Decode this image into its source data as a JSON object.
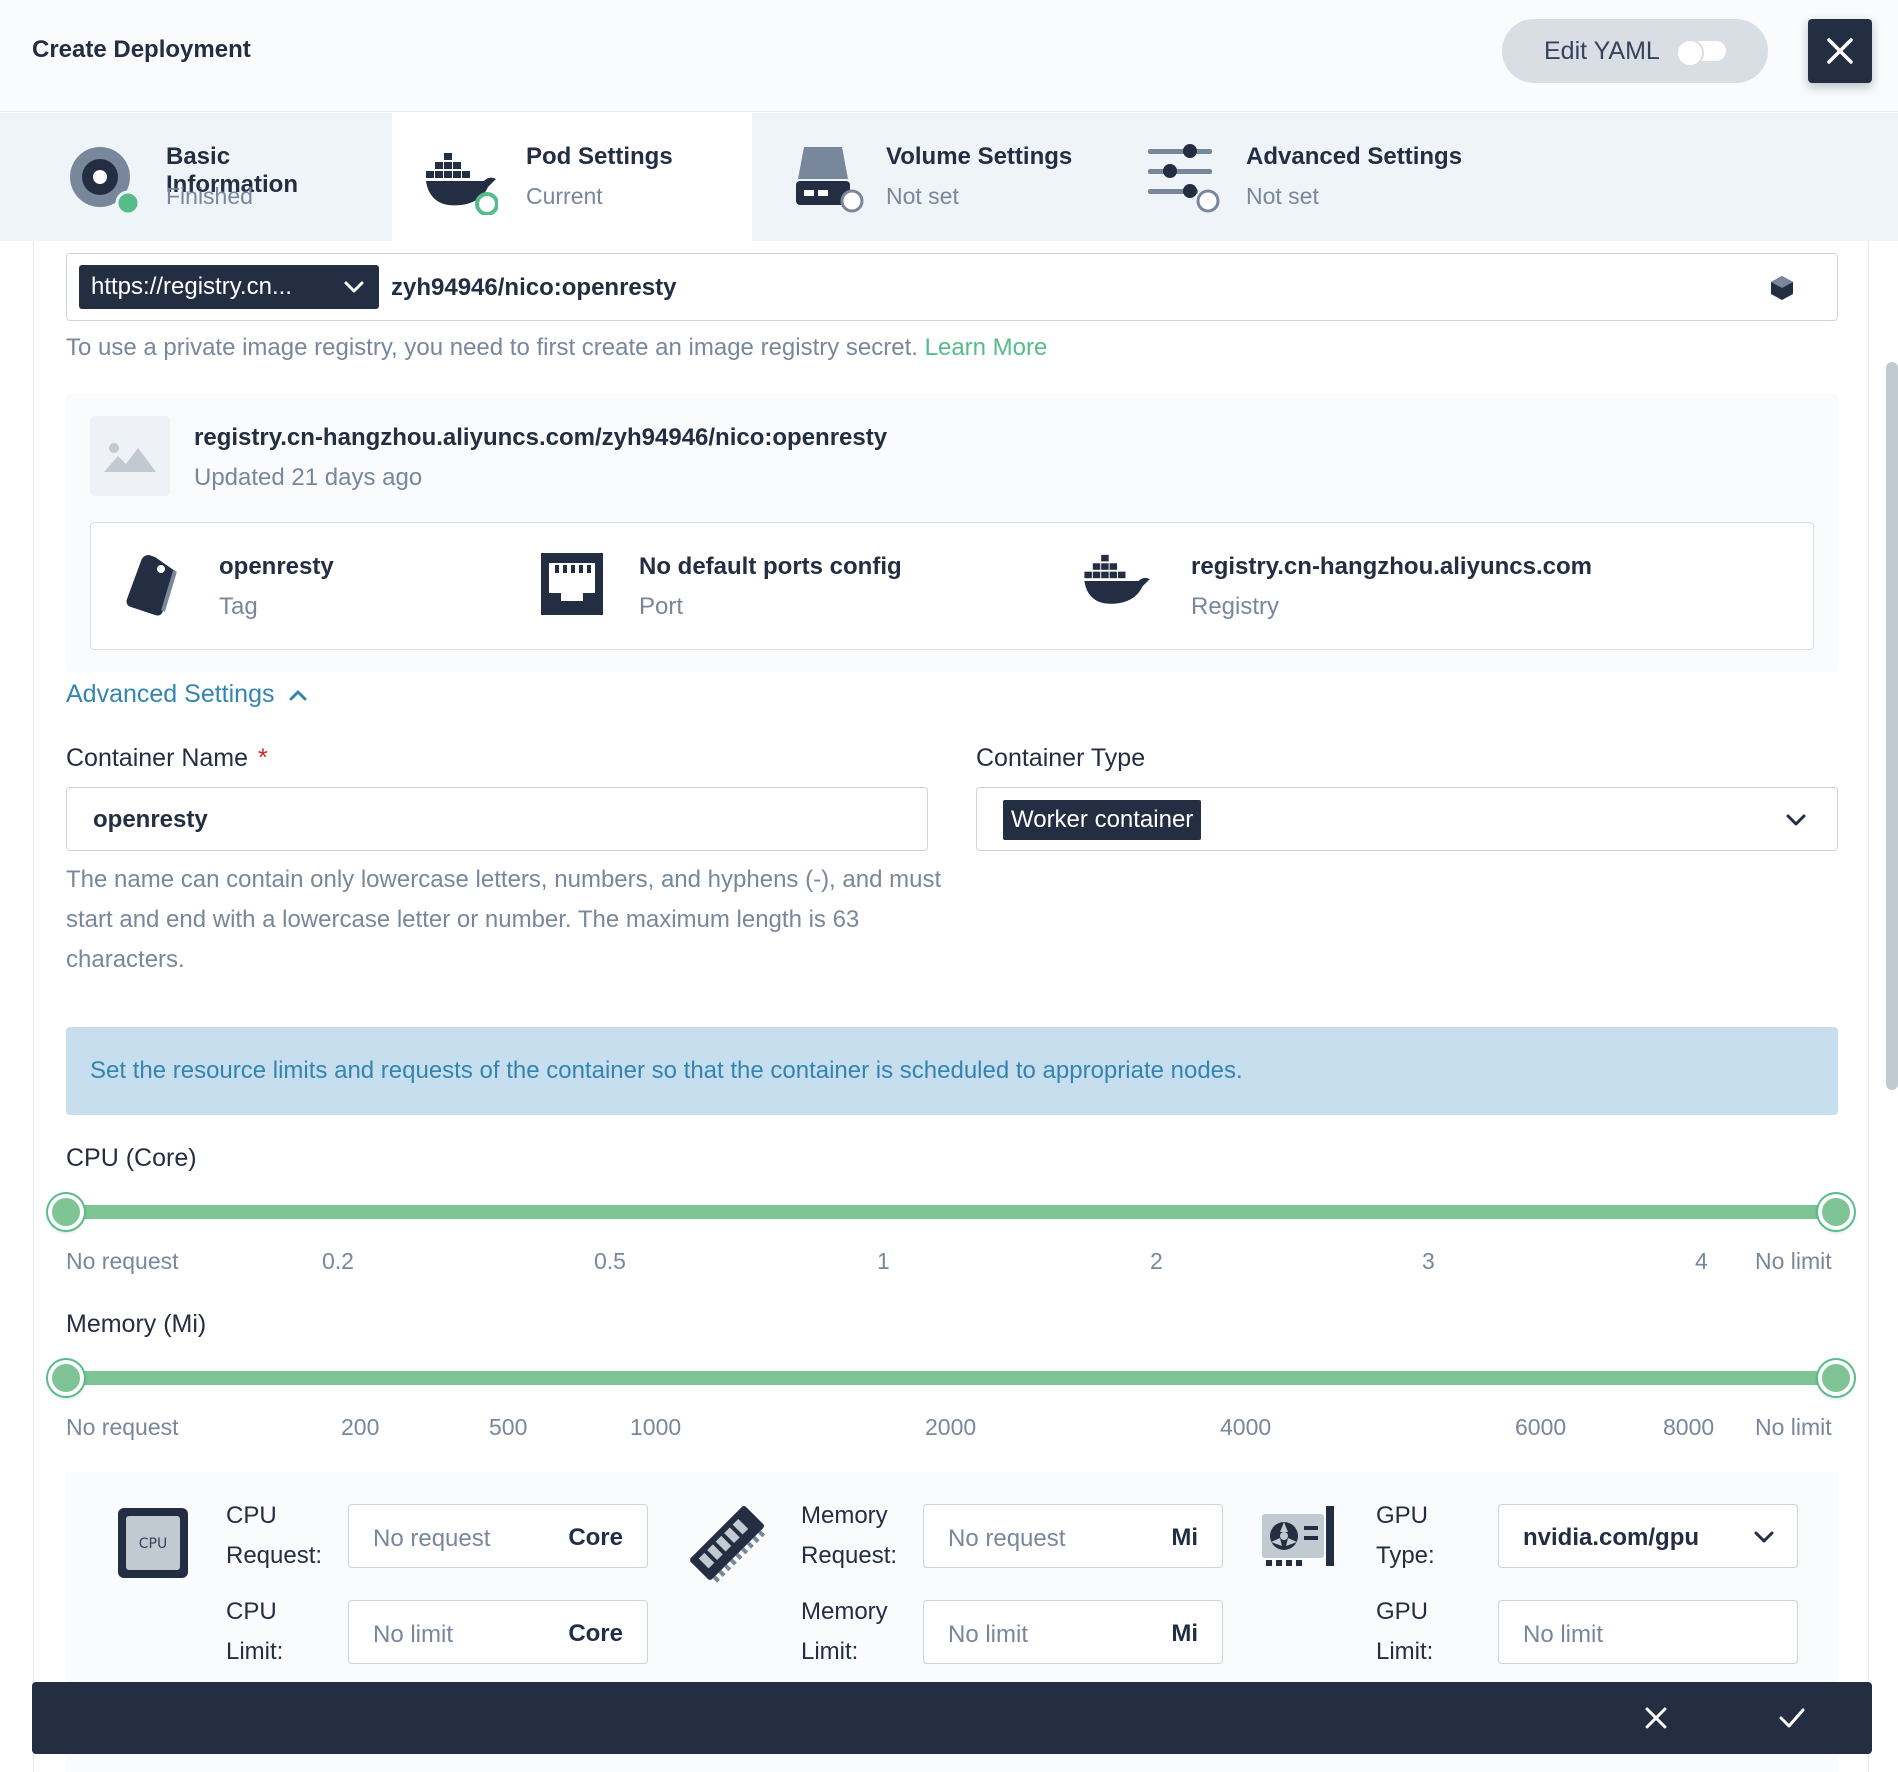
{
  "header": {
    "title": "Create Deployment",
    "edit_yaml_label": "Edit YAML"
  },
  "steps": [
    {
      "title": "Basic Information",
      "status": "Finished"
    },
    {
      "title": "Pod Settings",
      "status": "Current"
    },
    {
      "title": "Volume Settings",
      "status": "Not set"
    },
    {
      "title": "Advanced Settings",
      "status": "Not set"
    }
  ],
  "image": {
    "registry_selected": "https://registry.cn...",
    "name_value": "zyh94946/nico:openresty",
    "hint": "To use a private image registry, you need to first create an image registry secret.",
    "hint_link": "Learn More"
  },
  "image_card": {
    "full_name": "registry.cn-hangzhou.aliyuncs.com/zyh94946/nico:openresty",
    "updated": "Updated 21 days ago",
    "tag_value": "openresty",
    "tag_label": "Tag",
    "port_value": "No default ports config",
    "port_label": "Port",
    "registry_value": "registry.cn-hangzhou.aliyuncs.com",
    "registry_label": "Registry"
  },
  "advanced_toggle": "Advanced Settings",
  "container": {
    "name_label": "Container Name",
    "required_mark": "*",
    "name_value": "openresty",
    "name_help": "The name can contain only lowercase letters, numbers, and hyphens (-), and must start and end with a lowercase letter or number. The maximum length is 63 characters.",
    "type_label": "Container Type",
    "type_value": "Worker container"
  },
  "resource_info": "Set the resource limits and requests of the container so that the container is scheduled to appropriate nodes.",
  "cpu_slider": {
    "label": "CPU (Core)",
    "ticks": [
      "No request",
      "0.2",
      "0.5",
      "1",
      "2",
      "3",
      "4",
      "No limit"
    ],
    "request": "No request",
    "limit": "No limit"
  },
  "memory_slider": {
    "label": "Memory (Mi)",
    "ticks": [
      "No request",
      "200",
      "500",
      "1000",
      "2000",
      "4000",
      "6000",
      "8000",
      "No limit"
    ],
    "request": "No request",
    "limit": "No limit"
  },
  "resources": {
    "cpu_icon_text": "CPU",
    "cpu_request_label_1": "CPU",
    "cpu_request_label_2": "Request:",
    "cpu_request_placeholder": "No request",
    "cpu_unit": "Core",
    "cpu_limit_label_1": "CPU",
    "cpu_limit_label_2": "Limit:",
    "cpu_limit_placeholder": "No limit",
    "memory_request_label_1": "Memory",
    "memory_request_label_2": "Request:",
    "memory_request_placeholder": "No request",
    "memory_unit": "Mi",
    "memory_limit_label_1": "Memory",
    "memory_limit_label_2": "Limit:",
    "memory_limit_placeholder": "No limit",
    "gpu_type_label_1": "GPU",
    "gpu_type_label_2": "Type:",
    "gpu_type_value": "nvidia.com/gpu",
    "gpu_limit_label_1": "GPU",
    "gpu_limit_label_2": "Limit:",
    "gpu_limit_placeholder": "No limit"
  },
  "colors": {
    "primary_dark": "#242e42",
    "accent_green": "#55bc8a",
    "slider_green": "#7ec494",
    "link_blue": "#3385b0",
    "info_bg": "#c7deef",
    "required_red": "#ca2621"
  },
  "icons": {
    "close": "close-icon",
    "toggle": "toggle-icon",
    "chevron": "chevron-down-icon",
    "cube": "cube-icon",
    "image": "image-placeholder-icon",
    "tag": "tag-icon",
    "port": "ethernet-port-icon",
    "registry": "docker-icon",
    "cpu": "cpu-chip-icon",
    "memory": "memory-stick-icon",
    "gpu": "gpu-card-icon",
    "confirm": "check-icon"
  }
}
